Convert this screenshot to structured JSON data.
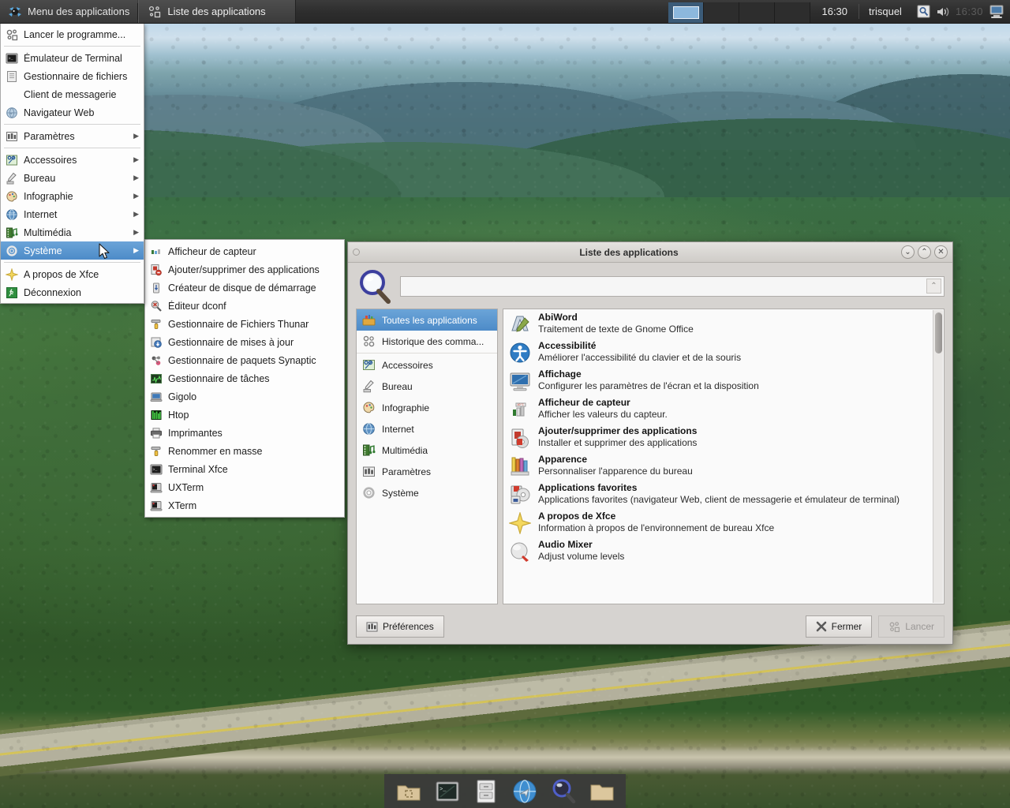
{
  "panel": {
    "app_menu_button": "Menu des applications",
    "app_menu_icon": "xfce-mouse-icon",
    "task_button": "Liste des applications",
    "task_button_icon": "appfinder-icon",
    "clock": "16:30",
    "username": "trisquel",
    "tray_clock_dim": "16:30",
    "workspace_count": 4,
    "workspace_active": 1,
    "tray_icons": [
      "search-tray-icon",
      "volume-icon",
      "display-icon"
    ]
  },
  "app_menu": {
    "groups": [
      {
        "items": [
          {
            "label": "Lancer le programme...",
            "icon": "run-program-icon",
            "submenu": false
          }
        ]
      },
      {
        "items": [
          {
            "label": "Émulateur de Terminal",
            "icon": "terminal-icon",
            "submenu": false
          },
          {
            "label": "Gestionnaire de fichiers",
            "icon": "file-manager-icon",
            "submenu": false
          },
          {
            "label": "Client de messagerie",
            "icon": "mail-icon",
            "submenu": false
          },
          {
            "label": "Navigateur Web",
            "icon": "web-browser-icon",
            "submenu": false
          }
        ]
      },
      {
        "items": [
          {
            "label": "Paramètres",
            "icon": "settings-icon",
            "submenu": true
          }
        ]
      },
      {
        "items": [
          {
            "label": "Accessoires",
            "icon": "accessories-icon",
            "submenu": true
          },
          {
            "label": "Bureau",
            "icon": "desktop-icon",
            "submenu": true
          },
          {
            "label": "Infographie",
            "icon": "graphics-icon",
            "submenu": true
          },
          {
            "label": "Internet",
            "icon": "internet-icon",
            "submenu": true
          },
          {
            "label": "Multimédia",
            "icon": "multimedia-icon",
            "submenu": true
          },
          {
            "label": "Système",
            "icon": "system-gear-icon",
            "submenu": true,
            "selected": true
          }
        ]
      },
      {
        "items": [
          {
            "label": "A propos de Xfce",
            "icon": "about-xfce-icon",
            "submenu": false
          },
          {
            "label": "Déconnexion",
            "icon": "logout-icon",
            "submenu": false
          }
        ]
      }
    ]
  },
  "system_submenu": {
    "items": [
      {
        "label": "Afficheur de capteur",
        "icon": "sensors-icon"
      },
      {
        "label": "Ajouter/supprimer des applications",
        "icon": "add-remove-apps-icon"
      },
      {
        "label": "Créateur de disque de démarrage",
        "icon": "usb-creator-icon"
      },
      {
        "label": "Éditeur dconf",
        "icon": "dconf-editor-icon"
      },
      {
        "label": "Gestionnaire de Fichiers Thunar",
        "icon": "thunar-icon"
      },
      {
        "label": "Gestionnaire de mises à jour",
        "icon": "update-manager-icon"
      },
      {
        "label": "Gestionnaire de paquets Synaptic",
        "icon": "synaptic-icon"
      },
      {
        "label": "Gestionnaire de tâches",
        "icon": "task-manager-icon"
      },
      {
        "label": "Gigolo",
        "icon": "gigolo-icon"
      },
      {
        "label": "Htop",
        "icon": "htop-icon"
      },
      {
        "label": "Imprimantes",
        "icon": "printer-icon"
      },
      {
        "label": "Renommer en masse",
        "icon": "bulk-rename-icon"
      },
      {
        "label": "Terminal Xfce",
        "icon": "terminal-icon"
      },
      {
        "label": "UXTerm",
        "icon": "uxterm-icon"
      },
      {
        "label": "XTerm",
        "icon": "xterm-icon"
      }
    ]
  },
  "appfinder": {
    "title": "Liste des applications",
    "window_buttons": {
      "minimize": "⌄",
      "maximize": "⌃",
      "close": "✕"
    },
    "search": {
      "value": "",
      "placeholder": "",
      "icon": "magnifier-icon",
      "expander_icon": "chevron-up-icon"
    },
    "categories": [
      {
        "label": "Toutes les applications",
        "icon": "all-applications-icon",
        "selected": true
      },
      {
        "label": "Historique des comma...",
        "icon": "command-history-icon",
        "selected": false
      },
      {
        "label": "Accessoires",
        "icon": "accessories-icon",
        "selected": false
      },
      {
        "label": "Bureau",
        "icon": "desktop-icon",
        "selected": false
      },
      {
        "label": "Infographie",
        "icon": "graphics-icon",
        "selected": false
      },
      {
        "label": "Internet",
        "icon": "internet-icon",
        "selected": false
      },
      {
        "label": "Multimédia",
        "icon": "multimedia-icon",
        "selected": false
      },
      {
        "label": "Paramètres",
        "icon": "settings-icon",
        "selected": false
      },
      {
        "label": "Système",
        "icon": "system-gear-icon",
        "selected": false
      }
    ],
    "applications": [
      {
        "name": "AbiWord",
        "desc": "Traitement de texte de Gnome Office",
        "icon": "abiword-icon"
      },
      {
        "name": "Accessibilité",
        "desc": "Améliorer l'accessibilité du clavier et de la souris",
        "icon": "accessibility-icon"
      },
      {
        "name": "Affichage",
        "desc": "Configurer les paramètres de l'écran et la disposition",
        "icon": "display-icon"
      },
      {
        "name": "Afficheur de capteur",
        "desc": "Afficher les valeurs du capteur.",
        "icon": "sensors-icon"
      },
      {
        "name": "Ajouter/supprimer des applications",
        "desc": "Installer et supprimer des applications",
        "icon": "add-remove-apps-icon"
      },
      {
        "name": "Apparence",
        "desc": "Personnaliser l'apparence du bureau",
        "icon": "appearance-icon"
      },
      {
        "name": "Applications favorites",
        "desc": "Applications favorites (navigateur Web, client de messagerie et émulateur de terminal)",
        "icon": "preferred-apps-icon"
      },
      {
        "name": "A propos de Xfce",
        "desc": "Information à propos de l'environnement de bureau Xfce",
        "icon": "about-xfce-icon"
      },
      {
        "name": "Audio Mixer",
        "desc": "Adjust volume levels",
        "icon": "audio-mixer-icon"
      }
    ],
    "buttons": {
      "preferences": "Préférences",
      "close": "Fermer",
      "launch": "Lancer",
      "preferences_icon": "preferences-icon",
      "close_icon": "close-x-icon",
      "launch_icon": "launch-icon"
    }
  },
  "dock": {
    "items": [
      {
        "icon": "home-folder-icon"
      },
      {
        "icon": "terminal-icon"
      },
      {
        "icon": "file-manager-icon"
      },
      {
        "icon": "web-browser-icon"
      },
      {
        "icon": "appfinder-magnifier-icon"
      },
      {
        "icon": "folder-icon"
      }
    ]
  },
  "colors": {
    "selection_blue": "#4d8bc8",
    "panel_dark": "#2e2e2e",
    "dialog_grey": "#d6d3d0"
  }
}
